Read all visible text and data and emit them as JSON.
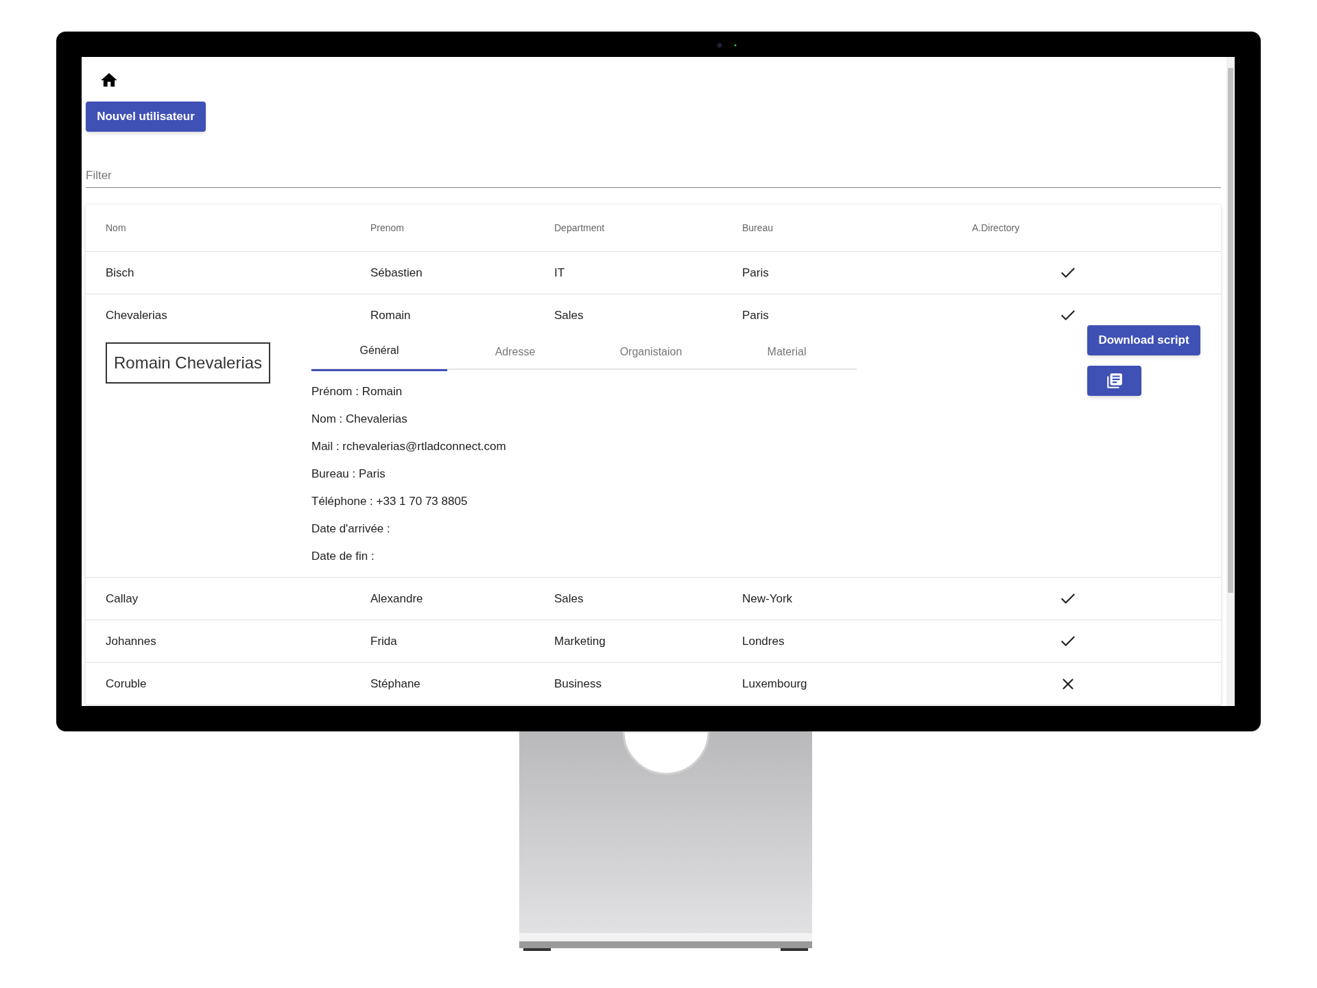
{
  "new_user_button": "Nouvel utilisateur",
  "filter": {
    "placeholder": "Filter"
  },
  "table": {
    "columns": [
      "Nom",
      "Prenom",
      "Department",
      "Bureau",
      "A.Directory"
    ],
    "rows": [
      {
        "nom": "Bisch",
        "prenom": "Sébastien",
        "department": "IT",
        "bureau": "Paris",
        "a_directory": true
      },
      {
        "nom": "Chevalerias",
        "prenom": "Romain",
        "department": "Sales",
        "bureau": "Paris",
        "a_directory": true,
        "details": {
          "name_card": "Romain Chevalerias",
          "tabs": [
            {
              "label": "Général",
              "selected": true
            },
            {
              "label": "Adresse",
              "selected": false
            },
            {
              "label": "Organistaion",
              "selected": false
            },
            {
              "label": "Material",
              "selected": false
            }
          ],
          "fields": [
            "Prénom : Romain",
            "Nom : Chevalerias",
            "Mail : rchevalerias@rtladconnect.com",
            "Bureau : Paris",
            "Téléphone : +33 1 70 73 8805",
            "Date d'arrivée :",
            "Date de fin :"
          ],
          "download_button": "Download script"
        }
      },
      {
        "nom": "Callay",
        "prenom": "Alexandre",
        "department": "Sales",
        "bureau": "New-York",
        "a_directory": true
      },
      {
        "nom": "Johannes",
        "prenom": "Frida",
        "department": "Marketing",
        "bureau": "Londres",
        "a_directory": true
      },
      {
        "nom": "Coruble",
        "prenom": "Stéphane",
        "department": "Business",
        "bureau": "Luxembourg",
        "a_directory": false
      }
    ]
  }
}
